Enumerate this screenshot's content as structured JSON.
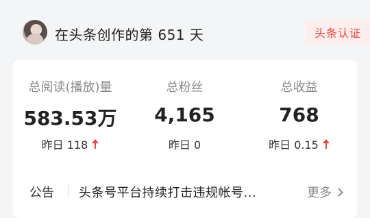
{
  "header": {
    "title": "在头条创作的第 651 天",
    "certification_label": "头条认证"
  },
  "stats": [
    {
      "label": "总阅读(播放)量",
      "value": "583.53万",
      "sub": "昨日 118",
      "trend": "up"
    },
    {
      "label": "总粉丝",
      "value": "4,165",
      "sub": "昨日 0",
      "trend": "none"
    },
    {
      "label": "总收益",
      "value": "768",
      "sub": "昨日 0.15",
      "trend": "up"
    }
  ],
  "notice": {
    "label": "公告",
    "text": "头条号平台持续打击违规帐号...",
    "more_label": "更多"
  },
  "colors": {
    "accent": "#f04142",
    "background": "#f4f5f6",
    "card": "#ffffff"
  }
}
